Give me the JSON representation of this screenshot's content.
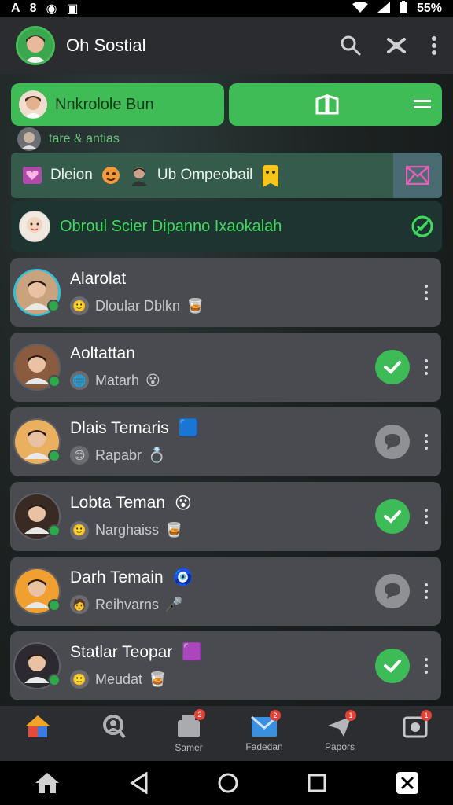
{
  "status_bar": {
    "left_icons": [
      "A",
      "8",
      "◉",
      "▣"
    ],
    "battery": "55%"
  },
  "app": {
    "title": "Oh Sostial"
  },
  "action_bar": {
    "primary_label": "Nnkrolole Bun"
  },
  "sub_status": "tare & antias",
  "banner": {
    "text_a": "Dleion",
    "text_b": "Ub Ompeobail"
  },
  "notice": {
    "text": "Obroul Scier Dipanno Ixaokalah"
  },
  "chats": [
    {
      "name": "Alarolat",
      "message": "Dloular Dblkn",
      "status": "none",
      "selected": true,
      "emoji": "",
      "msg_emoji": "🥃",
      "mini": "🙂",
      "face_color": "#c9a27e"
    },
    {
      "name": "Aoltattan",
      "message": "Matarh",
      "status": "ok",
      "selected": false,
      "emoji": "",
      "msg_emoji": "😮",
      "mini": "🌐",
      "face_color": "#8a5b3e"
    },
    {
      "name": "Dlais Temaris",
      "message": "Rapabr",
      "status": "chat",
      "selected": false,
      "emoji": "🟦",
      "msg_emoji": "💍",
      "mini": "😊",
      "face_color": "#e9b060"
    },
    {
      "name": "Lobta Teman",
      "message": "Narghaiss",
      "status": "ok",
      "selected": false,
      "emoji": "😮",
      "msg_emoji": "🥃",
      "mini": "🙂",
      "face_color": "#3a2a24"
    },
    {
      "name": "Darh Temain",
      "message": "Reihvarns",
      "status": "chat",
      "selected": false,
      "emoji": "🧿",
      "msg_emoji": "🎤",
      "mini": "🧑",
      "face_color": "#f0a030"
    },
    {
      "name": "Statlar Teopar",
      "message": "Meudat",
      "status": "ok",
      "selected": false,
      "emoji": "🟪",
      "msg_emoji": "🥃",
      "mini": "🙂",
      "face_color": "#2c2a30"
    }
  ],
  "bottom_nav": [
    {
      "icon": "home-icon",
      "label": "",
      "badge": ""
    },
    {
      "icon": "search-people-icon",
      "label": "",
      "badge": ""
    },
    {
      "icon": "inbox-icon",
      "label": "Samer",
      "badge": "2"
    },
    {
      "icon": "mail-icon",
      "label": "Fadedan",
      "badge": "2"
    },
    {
      "icon": "send-icon",
      "label": "Papors",
      "badge": "1"
    },
    {
      "icon": "photo-icon",
      "label": "",
      "badge": "1"
    }
  ],
  "colors": {
    "green": "#3fbc56",
    "header": "#2a2c2f",
    "row": "#4a4b50"
  }
}
